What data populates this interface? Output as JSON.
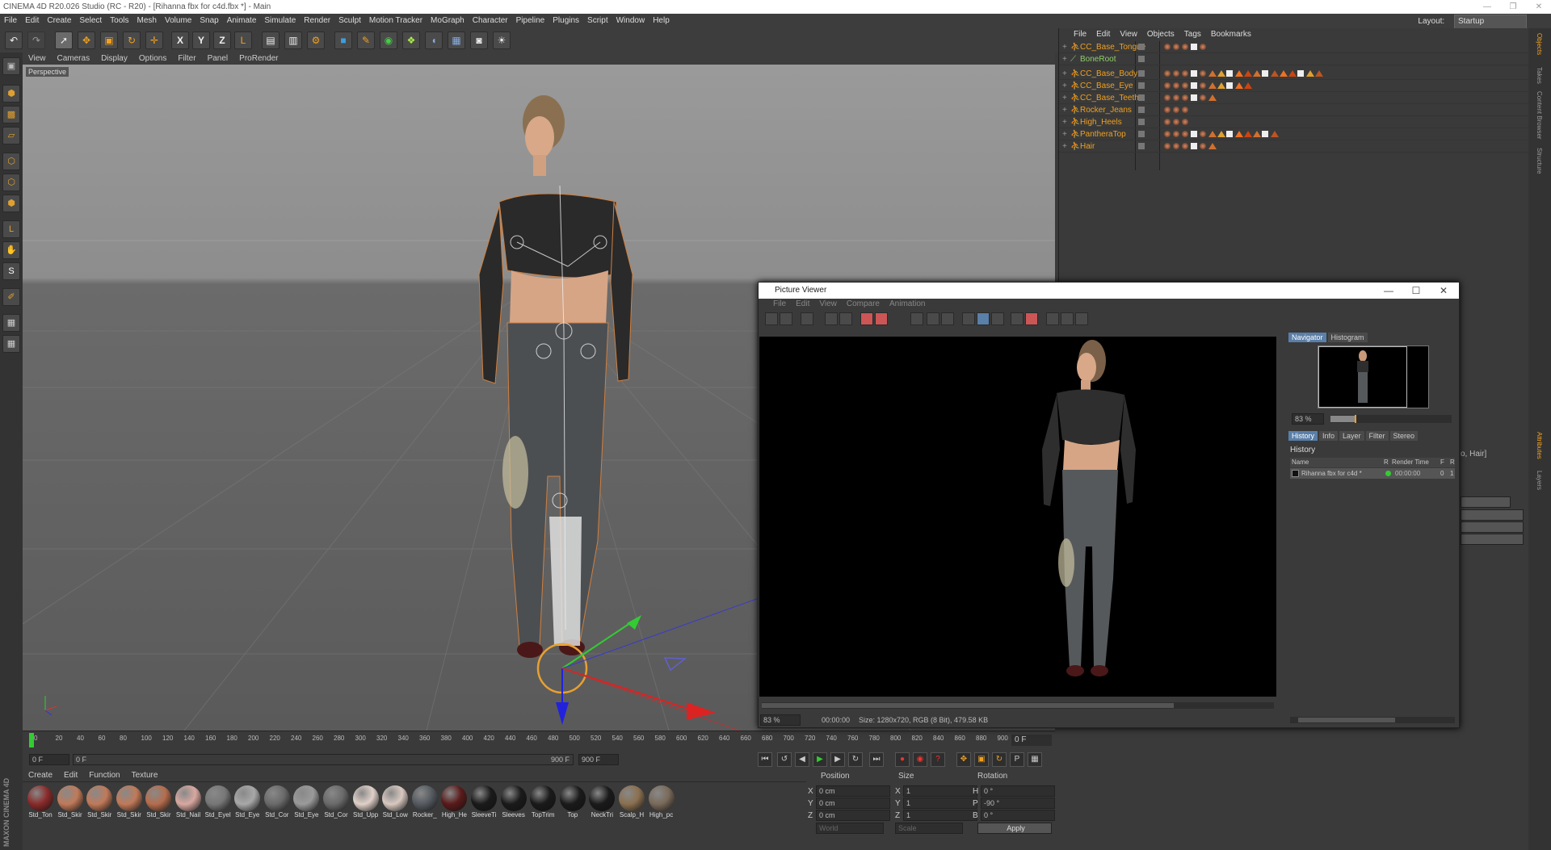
{
  "titlebar": {
    "title": "CINEMA 4D R20.026 Studio (RC - R20) - [Rihanna fbx for c4d.fbx *] - Main"
  },
  "menubar": {
    "items": [
      "File",
      "Edit",
      "Create",
      "Select",
      "Tools",
      "Mesh",
      "Volume",
      "Snap",
      "Animate",
      "Simulate",
      "Render",
      "Sculpt",
      "Motion Tracker",
      "MoGraph",
      "Character",
      "Pipeline",
      "Plugins",
      "Script",
      "Window",
      "Help"
    ],
    "layout_label": "Layout:",
    "layout_value": "Startup"
  },
  "toolbar": {
    "axis_x": "X",
    "axis_y": "Y",
    "axis_z": "Z"
  },
  "viewport": {
    "menu": [
      "View",
      "Cameras",
      "Display",
      "Options",
      "Filter",
      "Panel",
      "ProRender"
    ],
    "label": "Perspective"
  },
  "timeline": {
    "ticks": [
      "0",
      "20",
      "40",
      "60",
      "80",
      "100",
      "120",
      "140",
      "160",
      "180",
      "200",
      "220",
      "240",
      "260",
      "280",
      "300",
      "320",
      "340",
      "360",
      "380",
      "400",
      "420",
      "440",
      "460",
      "480",
      "500",
      "520",
      "540",
      "560",
      "580",
      "600",
      "620",
      "640",
      "660",
      "680",
      "700",
      "720",
      "740",
      "760",
      "780",
      "800",
      "820",
      "840",
      "860",
      "880",
      "900"
    ],
    "current_frame": "0 F",
    "start_field": "0 F",
    "start_field2": "0 F",
    "end_field": "900 F",
    "end_field2": "900 F"
  },
  "materials": {
    "menu": [
      "Create",
      "Edit",
      "Function",
      "Texture"
    ],
    "items": [
      {
        "label": "Std_Ton",
        "color": "#8a2a2a"
      },
      {
        "label": "Std_Skir",
        "color": "#c07a5a"
      },
      {
        "label": "Std_Skir",
        "color": "#c07a5a"
      },
      {
        "label": "Std_Skir",
        "color": "#c07a5a"
      },
      {
        "label": "Std_Skir",
        "color": "#b56d4d"
      },
      {
        "label": "Std_Nail",
        "color": "#d8a8a0"
      },
      {
        "label": "Std_Eyel",
        "color": "#777777"
      },
      {
        "label": "Std_Eye",
        "color": "#a8a8a8"
      },
      {
        "label": "Std_Cor",
        "color": "#6a6a6a"
      },
      {
        "label": "Std_Eye",
        "color": "#9a9a9a"
      },
      {
        "label": "Std_Cor",
        "color": "#6a6a6a"
      },
      {
        "label": "Std_Upp",
        "color": "#e0d0c8"
      },
      {
        "label": "Std_Low",
        "color": "#d8c8c0"
      },
      {
        "label": "Rocker_",
        "color": "#555a60"
      },
      {
        "label": "High_He",
        "color": "#5a1a1a"
      },
      {
        "label": "SleeveTi",
        "color": "#1a1a1a"
      },
      {
        "label": "Sleeves",
        "color": "#1a1a1a"
      },
      {
        "label": "TopTrim",
        "color": "#1a1a1a"
      },
      {
        "label": "Top",
        "color": "#1a1a1a"
      },
      {
        "label": "NeckTri",
        "color": "#1a1a1a"
      },
      {
        "label": "Scalp_H",
        "color": "#8a7050"
      },
      {
        "label": "High_pc",
        "color": "#7a6a5a"
      }
    ]
  },
  "coordinates": {
    "headers": {
      "position": "Position",
      "size": "Size",
      "rotation": "Rotation"
    },
    "rows": [
      {
        "axis": "X",
        "pos": "0 cm",
        "size_axis": "X",
        "size": "1",
        "rot_axis": "H",
        "rot": "0 °"
      },
      {
        "axis": "Y",
        "pos": "0 cm",
        "size_axis": "Y",
        "size": "1",
        "rot_axis": "P",
        "rot": "-90 °"
      },
      {
        "axis": "Z",
        "pos": "0 cm",
        "size_axis": "Z",
        "size": "1",
        "rot_axis": "B",
        "rot": "0 °"
      }
    ],
    "mode1": "World",
    "mode2": "Scale",
    "apply": "Apply"
  },
  "object_manager": {
    "menu": [
      "File",
      "Edit",
      "View",
      "Objects",
      "Tags",
      "Bookmarks"
    ],
    "objects": [
      {
        "name": "CC_Base_Tongue",
        "tags": 5
      },
      {
        "name": "BoneRoot",
        "tags": 0,
        "bone": true
      },
      {
        "name": "CC_Base_Body",
        "tags": 18
      },
      {
        "name": "CC_Base_Eye",
        "tags": 10
      },
      {
        "name": "CC_Base_Teeth",
        "tags": 6
      },
      {
        "name": "Rocker_Jeans",
        "tags": 3
      },
      {
        "name": "High_Heels",
        "tags": 3
      },
      {
        "name": "PantheraTop",
        "tags": 13
      },
      {
        "name": "Hair",
        "tags": 6
      }
    ]
  },
  "picture_viewer": {
    "title": "Picture Viewer",
    "menu": [
      "File",
      "Edit",
      "View",
      "Compare",
      "Animation"
    ],
    "zoom": "83 %",
    "time": "00:00:00",
    "size_info": "Size: 1280x720, RGB (8 Bit), 479.58 KB",
    "nav_tabs": [
      "Navigator",
      "Histogram"
    ],
    "nav_zoom": "83 %",
    "hist_tabs": [
      "History",
      "Info",
      "Layer",
      "Filter",
      "Stereo"
    ],
    "history_title": "History",
    "cols": {
      "name": "Name",
      "r": "R",
      "render_time": "Render Time",
      "f": "F",
      "r2": "R"
    },
    "entry": {
      "name": "Rihanna fbx for c4d *",
      "time": "00:00:00",
      "f": "0",
      "r": "1"
    }
  },
  "attr_hint": "o, Hair]",
  "right_tabs": [
    "Objects",
    "Takes",
    "Content Browser",
    "Structure",
    "Attributes",
    "Layers"
  ],
  "brand": "MAXON CINEMA 4D"
}
